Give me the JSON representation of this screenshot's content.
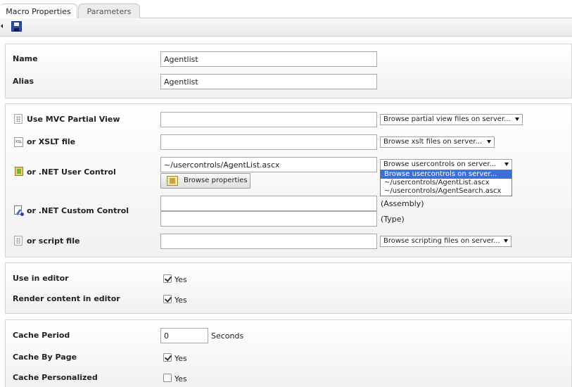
{
  "tabs": [
    {
      "label": "Macro Properties",
      "active": true
    },
    {
      "label": "Parameters",
      "active": false
    }
  ],
  "toolbar": {
    "save_icon": "save-icon"
  },
  "properties": {
    "name_label": "Name",
    "name_value": "Agentlist",
    "alias_label": "Alias",
    "alias_value": "Agentlist"
  },
  "sources": {
    "mvc_label": "Use MVC Partial View",
    "mvc_value": "",
    "mvc_browse": "Browse partial view files on server...",
    "xslt_label": "or XSLT file",
    "xslt_value": "",
    "xslt_browse": "Browse xslt files on server...",
    "uc_label": "or .NET User Control",
    "uc_value": "~/usercontrols/AgentList.ascx",
    "uc_browse": "Browse usercontrols on server...",
    "uc_options": [
      "Browse usercontrols on server...",
      "~/usercontrols/AgentList.ascx",
      "~/usercontrols/AgentSearch.ascx"
    ],
    "browse_properties": "Browse properties",
    "cc_label": "or .NET Custom Control",
    "cc_assembly_value": "",
    "cc_assembly_suffix": "(Assembly)",
    "cc_type_value": "",
    "cc_type_suffix": "(Type)",
    "script_label": "or script file",
    "script_value": "",
    "script_browse": "Browse scripting files on server..."
  },
  "editor": {
    "use_label": "Use in editor",
    "use_checked": true,
    "use_yes": "Yes",
    "render_label": "Render content in editor",
    "render_checked": true,
    "render_yes": "Yes"
  },
  "cache": {
    "period_label": "Cache Period",
    "period_value": "0",
    "period_unit": "Seconds",
    "by_page_label": "Cache By Page",
    "by_page_checked": true,
    "by_page_yes": "Yes",
    "personalized_label": "Cache Personalized",
    "personalized_checked": false,
    "personalized_yes": "Yes"
  }
}
